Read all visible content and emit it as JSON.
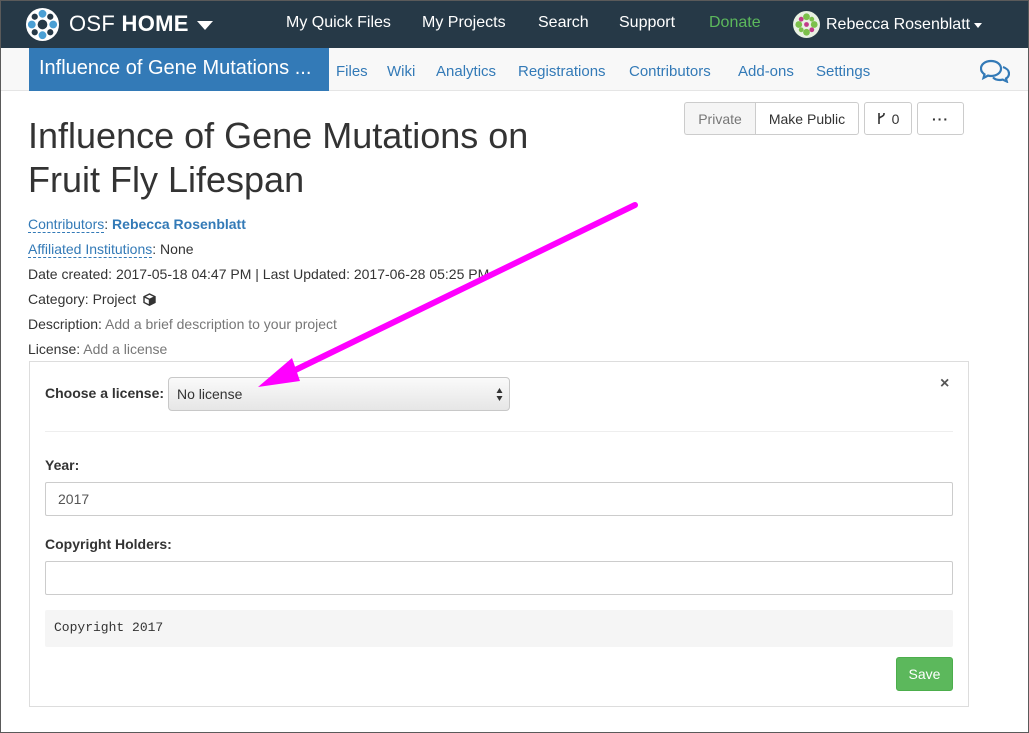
{
  "topnav": {
    "brand_osf": "OSF",
    "brand_home": "HOME",
    "links": {
      "quick_files": "My Quick Files",
      "projects": "My Projects",
      "search": "Search",
      "support": "Support",
      "donate": "Donate"
    },
    "user_name": "Rebecca Rosenblatt"
  },
  "project_nav": {
    "title_tab": "Influence of Gene Mutations ...",
    "links": {
      "files": "Files",
      "wiki": "Wiki",
      "analytics": "Analytics",
      "registrations": "Registrations",
      "contributors": "Contributors",
      "addons": "Add-ons",
      "settings": "Settings"
    }
  },
  "header_buttons": {
    "private": "Private",
    "make_public": "Make Public",
    "fork_count": "0",
    "more": "···"
  },
  "project": {
    "title": "Influence of Gene Mutations on Fruit Fly Lifespan",
    "contributors_label": "Contributors",
    "contributor_name": "Rebecca Rosenblatt",
    "affiliated_label": "Affiliated Institutions",
    "affiliated_value": "None",
    "date_line": "Date created: 2017-05-18 04:47 PM | Last Updated: 2017-06-28 05:25 PM",
    "category_label": "Category:",
    "category_value": "Project",
    "description_label": "Description:",
    "description_placeholder": "Add a brief description to your project",
    "license_label": "License:",
    "license_placeholder": "Add a license"
  },
  "license_panel": {
    "choose_label": "Choose a license:",
    "selected_license": "No license",
    "year_label": "Year:",
    "year_value": "2017",
    "holders_label": "Copyright Holders:",
    "holders_value": "",
    "preview_text": "Copyright 2017",
    "save_label": "Save",
    "close_symbol": "×"
  },
  "colors": {
    "navbar_bg": "#263947",
    "link_blue": "#337ab7",
    "donate_green": "#5cb85c",
    "annotation_magenta": "#ff00ff"
  },
  "icons": {
    "brand": "osf-logo-icon",
    "chat": "comments-icon",
    "fork": "code-fork-icon",
    "category": "cube-icon",
    "close": "close-icon",
    "select": "select-arrows-icon"
  }
}
